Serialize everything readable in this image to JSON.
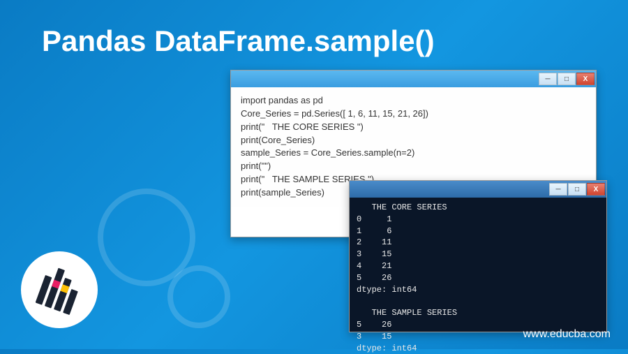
{
  "title": "Pandas DataFrame.sample()",
  "code_window": {
    "lines": [
      "import pandas as pd",
      "Core_Series = pd.Series([ 1, 6, 11, 15, 21, 26])",
      "print(\"   THE CORE SERIES \")",
      "print(Core_Series)",
      "sample_Series = Core_Series.sample(n=2)",
      "print(\"\")",
      "print(\"   THE SAMPLE SERIES \")",
      "print(sample_Series)"
    ],
    "buttons": {
      "min": "─",
      "max": "□",
      "close": "X"
    }
  },
  "console_window": {
    "header1": "   THE CORE SERIES ",
    "rows1": [
      "0     1",
      "1     6",
      "2    11",
      "3    15",
      "4    21",
      "5    26"
    ],
    "dtype1": "dtype: int64",
    "blank": "",
    "header2": "   THE SAMPLE SERIES ",
    "rows2": [
      "5    26",
      "3    15"
    ],
    "dtype2": "dtype: int64",
    "buttons": {
      "min": "─",
      "max": "□",
      "close": "X"
    }
  },
  "website": "www.educba.com",
  "logo_name": "educba-logo"
}
